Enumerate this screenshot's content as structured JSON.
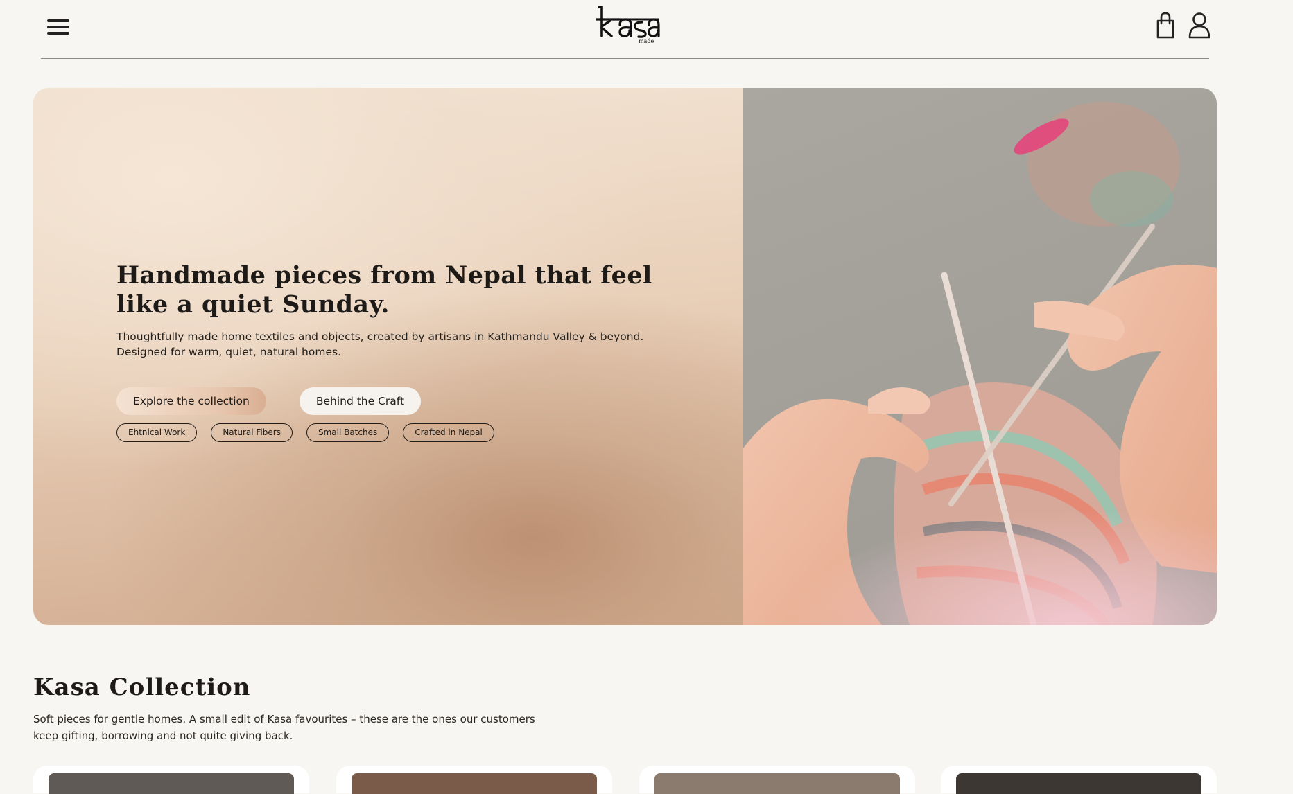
{
  "header": {
    "menu_icon": "hamburger-menu-icon",
    "logo_text": "kasa",
    "logo_subtext": "made",
    "cart_icon": "shopping-bag-icon",
    "account_icon": "user-icon"
  },
  "hero": {
    "title": "Handmade pieces from Nepal that feel like a quiet Sunday.",
    "subtitle": "Thoughtfully made home textiles and objects, created by artisans in Kathmandu Valley & beyond. Designed for warm, quiet, natural homes.",
    "primary_button": "Explore the collection",
    "secondary_button": "Behind the Craft",
    "tags": [
      "Ehtnical Work",
      "Natural Fibers",
      "Small Batches",
      "Crafted in Nepal"
    ],
    "image_alt": "hands knitting with chunky multicolor yarn"
  },
  "collection": {
    "title": "Kasa Collection",
    "subtitle": "Soft pieces for gentle homes. A small edit of Kasa favourites – these are the ones our customers keep gifting, borrowing and not quite giving back."
  },
  "colors": {
    "background": "#f8f6f2",
    "text": "#1e1b18",
    "accent": "#d9ae92"
  }
}
